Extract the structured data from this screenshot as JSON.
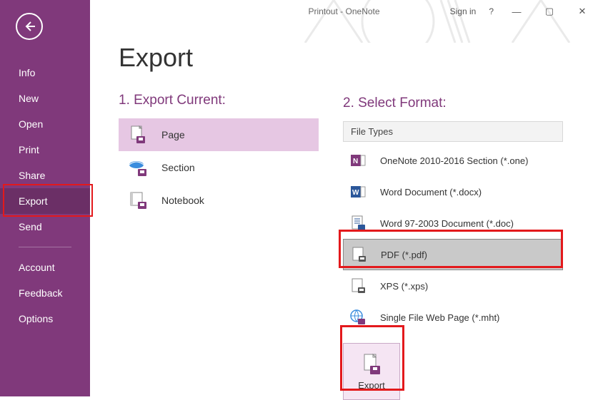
{
  "title": {
    "doc": "Printout",
    "app": "OneNote",
    "signin": "Sign in",
    "help": "?"
  },
  "sidebar": {
    "items": [
      "Info",
      "New",
      "Open",
      "Print",
      "Share",
      "Export",
      "Send",
      "Account",
      "Feedback",
      "Options"
    ],
    "active_index": 5
  },
  "page": {
    "heading": "Export"
  },
  "export_current": {
    "label": "1. Export Current:",
    "options": [
      "Page",
      "Section",
      "Notebook"
    ],
    "selected_index": 0
  },
  "select_format": {
    "label": "2. Select Format:",
    "group": "File Types",
    "options": [
      "OneNote 2010-2016 Section (*.one)",
      "Word Document (*.docx)",
      "Word 97-2003 Document (*.doc)",
      "PDF (*.pdf)",
      "XPS (*.xps)",
      "Single File Web Page (*.mht)"
    ],
    "selected_index": 3,
    "button": "Export"
  }
}
